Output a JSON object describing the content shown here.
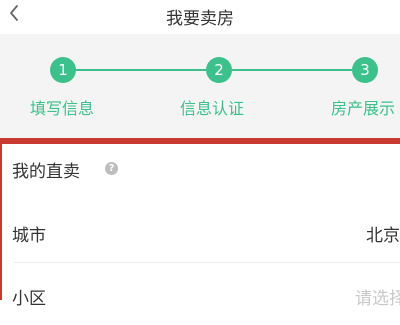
{
  "header": {
    "title": "我要卖房",
    "back_icon": "chevron-left-icon"
  },
  "steps": [
    {
      "number": "1",
      "label": "填写信息"
    },
    {
      "number": "2",
      "label": "信息认证"
    },
    {
      "number": "3",
      "label": "房产展示"
    }
  ],
  "colors": {
    "accent": "#3cc08c",
    "highlight_border": "#c93b31",
    "placeholder": "#c8c8c8"
  },
  "form": {
    "section_title": "我的直卖",
    "help_icon": "question-circle-icon",
    "city_label": "城市",
    "city_value": "北京",
    "community_label": "小区",
    "community_placeholder": "请选择"
  }
}
